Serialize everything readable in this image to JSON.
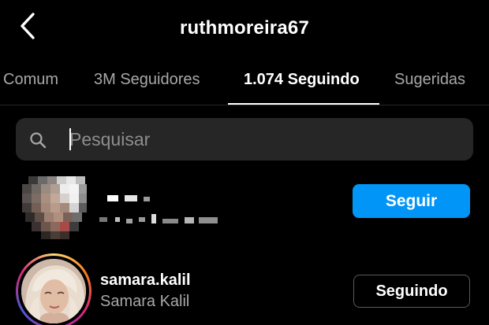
{
  "header": {
    "title": "ruthmoreira67",
    "back_icon": "chevron-left-icon"
  },
  "tabs": [
    {
      "label": "Comum",
      "active": false
    },
    {
      "label": "3M Seguidores",
      "active": false
    },
    {
      "label": "1.074 Seguindo",
      "active": true
    },
    {
      "label": "Sugeridas",
      "active": false
    }
  ],
  "search": {
    "placeholder": "Pesquisar",
    "value": "",
    "icon": "search-icon"
  },
  "list": [
    {
      "username": "",
      "fullname": "",
      "avatar": "pixelated-avatar",
      "button_label": "Seguir",
      "button_style": "primary"
    },
    {
      "username": "samara.kalil",
      "fullname": "Samara Kalil",
      "avatar": "story-ring-avatar",
      "button_label": "Seguindo",
      "button_style": "secondary"
    }
  ],
  "colors": {
    "background": "#000000",
    "accent": "#0095f6",
    "muted_text": "#a8a8a8",
    "search_bg": "#262626"
  }
}
